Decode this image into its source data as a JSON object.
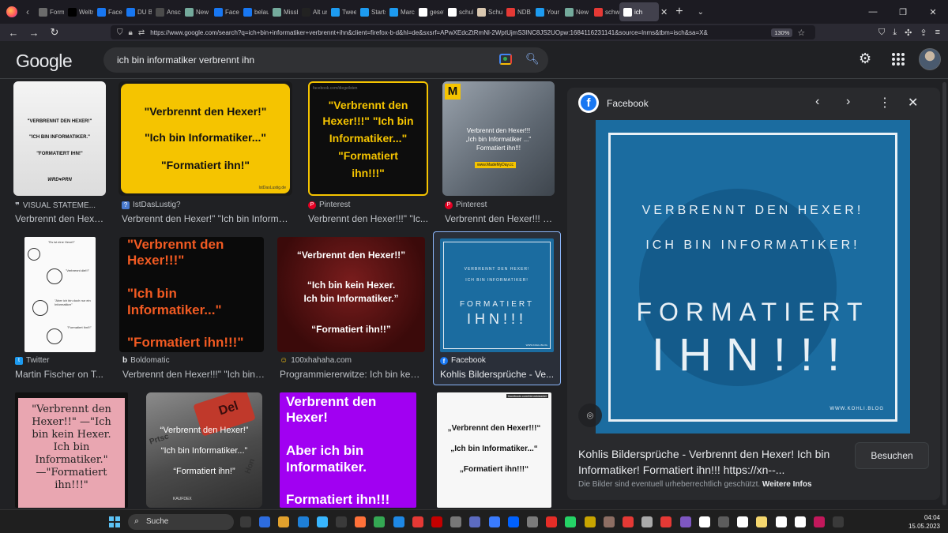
{
  "browser": {
    "tabs": [
      {
        "label": "Form",
        "color": "#6b6b6b"
      },
      {
        "label": "Weltr",
        "color": "#000000"
      },
      {
        "label": "Faceb",
        "color": "#1877f2"
      },
      {
        "label": "DU Bl",
        "color": "#1877f2"
      },
      {
        "label": "Ansch",
        "color": "#4b4b4b"
      },
      {
        "label": "New c",
        "color": "#74aa9c"
      },
      {
        "label": "Faceb",
        "color": "#1877f2"
      },
      {
        "label": "belaus",
        "color": "#1877f2"
      },
      {
        "label": "Missb",
        "color": "#74aa9c"
      },
      {
        "label": "Alt un",
        "color": "#222222"
      },
      {
        "label": "Tweet",
        "color": "#1d9bf0"
      },
      {
        "label": "Startse",
        "color": "#1d9bf0"
      },
      {
        "label": "Marc",
        "color": "#1d9bf0"
      },
      {
        "label": "gesetz",
        "color": "#ffffff"
      },
      {
        "label": "schule",
        "color": "#ffffff"
      },
      {
        "label": "Schul",
        "color": "#d9c7b0"
      },
      {
        "label": "NDB /",
        "color": "#e53935"
      },
      {
        "label": "Your",
        "color": "#1d9bf0"
      },
      {
        "label": "New c",
        "color": "#74aa9c"
      },
      {
        "label": "schwe",
        "color": "#e53935"
      },
      {
        "label": "ich",
        "color": "#ffffff"
      }
    ],
    "url": "https://www.google.com/search?q=ich+bin+informatiker+verbrennt+ihn&client=firefox-b-d&hl=de&sxsrf=APwXEdcZtRmNl-2WptUjmS3INC8JS2UOpw:1684116231141&source=lnms&tbm=isch&sa=X&",
    "zoom": "130%"
  },
  "google": {
    "logo": "Google",
    "query": "ich bin informatiker verbrennt ihn"
  },
  "results": [
    {
      "source": "VISUAL STATEME...",
      "title": "Verbrennt den Hexe...",
      "fav_color": "#ffffff",
      "fav_glyph": "❞",
      "lines": [
        "\"VERBRENNT DEN HEXER!\"",
        "\"ICH BIN INFORMATIKER.\"",
        "\"FORMATIERT IHN!\""
      ],
      "brand": "WRD♥PRN"
    },
    {
      "source": "IstDasLustig?",
      "title": "Verbrennt den Hexer!\" \"Ich bin Informat...",
      "fav_color": "#4a7bd0",
      "fav_glyph": "?",
      "lines": [
        "\"Verbrennt den Hexer!\"",
        "\"Ich bin Informatiker...\"",
        "\"Formatiert ihn!\""
      ],
      "brand": "IstDasLustig.de"
    },
    {
      "source": "Pinterest",
      "title": "Verbrennt den Hexer!!!\" \"Ic...",
      "fav_color": "#e60023",
      "fav_glyph": "P",
      "lines": [
        "\"Verbrennt den",
        "Hexer!!!\" \"Ich bin",
        "Informatiker...\"",
        "\"Formatiert",
        "ihn!!!\""
      ],
      "brand": "facebook.com/diegeilsten"
    },
    {
      "source": "Pinterest",
      "title": "Verbrennt den Hexer!!! \"I...",
      "fav_color": "#e60023",
      "fav_glyph": "P",
      "lines": [
        "Verbrennt den Hexer!!!",
        "„Ich bin Informatiker ...\"",
        "Formatiert ihn!!!"
      ],
      "badge": "M",
      "brand": "www.MadeMyDay.cc"
    },
    {
      "source": "Twitter",
      "title": "Martin Fischer on T...",
      "fav_color": "#1d9bf0",
      "fav_glyph": "t",
      "lines": [
        "\"Es ist eine Hexe!!\"",
        "\"Verbrennt die!!!\"",
        "\"Aber ich bin doch nur ein Informatiker\"",
        "\"Formatiert ihn!!!\""
      ]
    },
    {
      "source": "Boldomatic",
      "title": "Verbrennt den Hexer!!!\" \"Ich bin ...",
      "fav_color": "#222222",
      "fav_glyph": "b",
      "lines": [
        "\"Verbrennt den",
        "Hexer!!!\"",
        "\"Ich bin",
        "Informatiker...\"",
        "\"Formatiert ihn!!!\""
      ]
    },
    {
      "source": "100xhahaha.com",
      "title": "Programmiererwitze: Ich bin kein...",
      "fav_color": "#f9c513",
      "fav_glyph": "☺",
      "lines": [
        "“Verbrennt den Hexer!!”",
        "“Ich bin kein Hexer.",
        "Ich bin Informatiker.”",
        "“Formatiert ihn!!”"
      ]
    },
    {
      "source": "Facebook",
      "title": "Kohlis Bildersprüche - Ve...",
      "fav_color": "#1877f2",
      "fav_glyph": "f",
      "lines": [
        "VERBRENNT DEN HEXER!",
        "ICH BIN INFORMATIKER!",
        "FORMATIERT",
        "IHN!!!"
      ],
      "brand": "WWW.KOHLI.BLOG"
    },
    {
      "lines": [
        "\"Verbrennt den",
        "Hexer!!\" —\"Ich",
        "bin kein Hexer.",
        "Ich bin",
        "Informatiker.\"",
        "—\"Formatiert",
        "ihn!!!\""
      ]
    },
    {
      "lines": [
        "“Verbrennt den Hexer!”",
        "“Ich bin Informatiker...”",
        "“Formatiert ihn!”"
      ],
      "keys": [
        "Del",
        "Prtsc",
        "Hon"
      ],
      "brand": "KAUFDEX"
    },
    {
      "lines": [
        "Verbrennt den",
        "Hexer!",
        "Aber ich bin",
        "Informatiker.",
        "Formatiert ihn!!!"
      ]
    },
    {
      "lines": [
        "„Verbrennt den Hexer!!!“",
        "„Ich bin Informatiker...“",
        "„Formatiert ihn!!!“"
      ],
      "brand": "facebook.com/bimmtdasbei"
    }
  ],
  "preview": {
    "site": "Facebook",
    "image_lines": [
      "VERBRENNT DEN HEXER!",
      "ICH BIN INFORMATIKER!",
      "FORMATIERT",
      "IHN!!!"
    ],
    "image_brand": "WWW.KOHLI.BLOG",
    "title": "Kohlis Bildersprüche - Verbrennt den Hexer! Ich bin Informatiker! Formatiert ihn!!! https://xn--...",
    "visit_label": "Besuchen",
    "copyright_note": "Die Bilder sind eventuell urheberrechtlich geschützt.",
    "more_info": "Weitere Infos"
  },
  "taskbar": {
    "search_label": "Suche",
    "time": "04:04",
    "date": "15.05.2023",
    "app_colors": [
      "#3a3a3a",
      "#2d6cdf",
      "#e2a12d",
      "#1e7fd7",
      "#38b6ff",
      "#3a3a3a",
      "#ff7139",
      "#34a853",
      "#1e88e5",
      "#e53935",
      "#c40000",
      "#777777",
      "#5c6bc0",
      "#3a7bfd",
      "#0061fe",
      "#7b7b7b",
      "#e52d27",
      "#25d366",
      "#c8a400",
      "#8d6e63",
      "#e53935",
      "#aaaaaa",
      "#e53935",
      "#7e57c2",
      "#ffffff",
      "#5c5c5c",
      "#ffffff",
      "#f5d76e",
      "#ffffff",
      "#ffffff",
      "#c2185b",
      "#3a3a3a"
    ]
  }
}
